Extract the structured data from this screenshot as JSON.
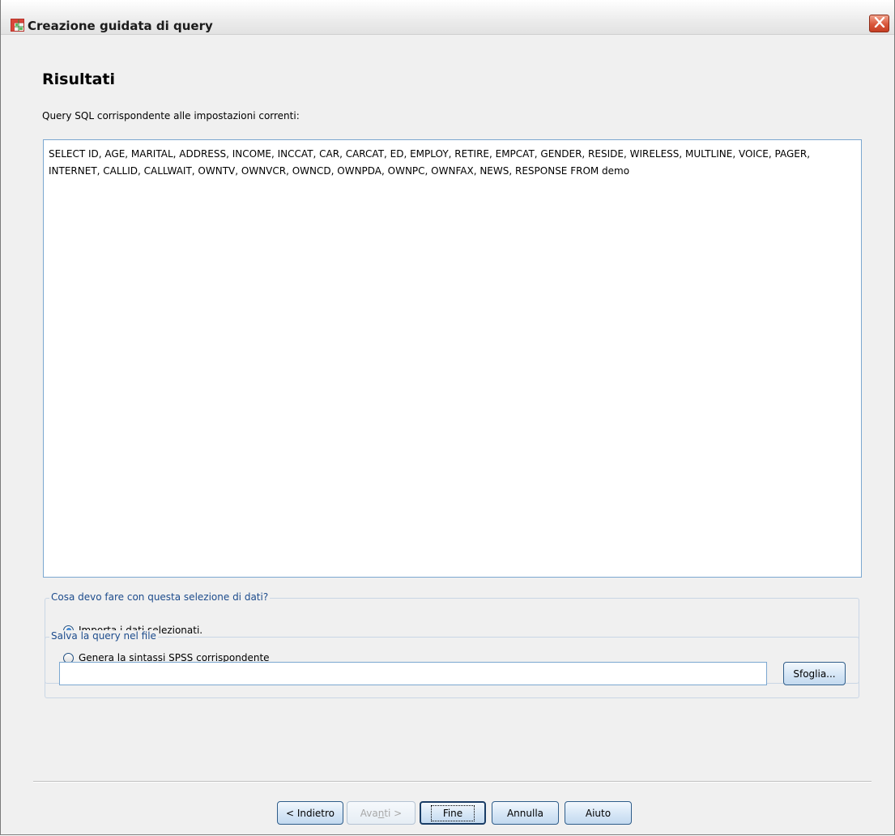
{
  "window": {
    "title": "Creazione guidata di query",
    "icon": "spreadsheet-grid-icon",
    "close_icon": "close-x-icon"
  },
  "page": {
    "title": "Risultati",
    "subtitle": "Query SQL corrispondente alle impostazioni correnti:"
  },
  "sql": {
    "text": "SELECT ID, AGE, MARITAL, ADDRESS, INCOME, INCCAT, CAR, CARCAT, ED, EMPLOY, RETIRE, EMPCAT, GENDER, RESIDE, WIRELESS, MULTLINE, VOICE, PAGER, INTERNET, CALLID, CALLWAIT, OWNTV, OWNVCR, OWNCD, OWNPDA, OWNPC, OWNFAX, NEWS, RESPONSE FROM demo"
  },
  "action_group": {
    "legend": "Cosa devo fare con questa selezione di dati?",
    "options": [
      {
        "label_pre": "Impo",
        "mnemonic": "r",
        "label_post": "ta i dati selezionati.",
        "selected": true
      },
      {
        "label_pre": "Genera la sintassi S",
        "mnemonic": "P",
        "label_post": "SS corrispondente",
        "selected": false
      }
    ]
  },
  "save_group": {
    "legend": "Salva la query nel file",
    "file_value": "",
    "browse_label": "Sfoglia..."
  },
  "buttons": {
    "back": "< Indietro",
    "next_pre": "Ava",
    "next_mnemonic": "n",
    "next_post": "ti >",
    "finish": "Fine",
    "cancel": "Annulla",
    "help": "Aiuto"
  },
  "colors": {
    "accent": "#1c4b8c",
    "close": "#d9573b"
  }
}
